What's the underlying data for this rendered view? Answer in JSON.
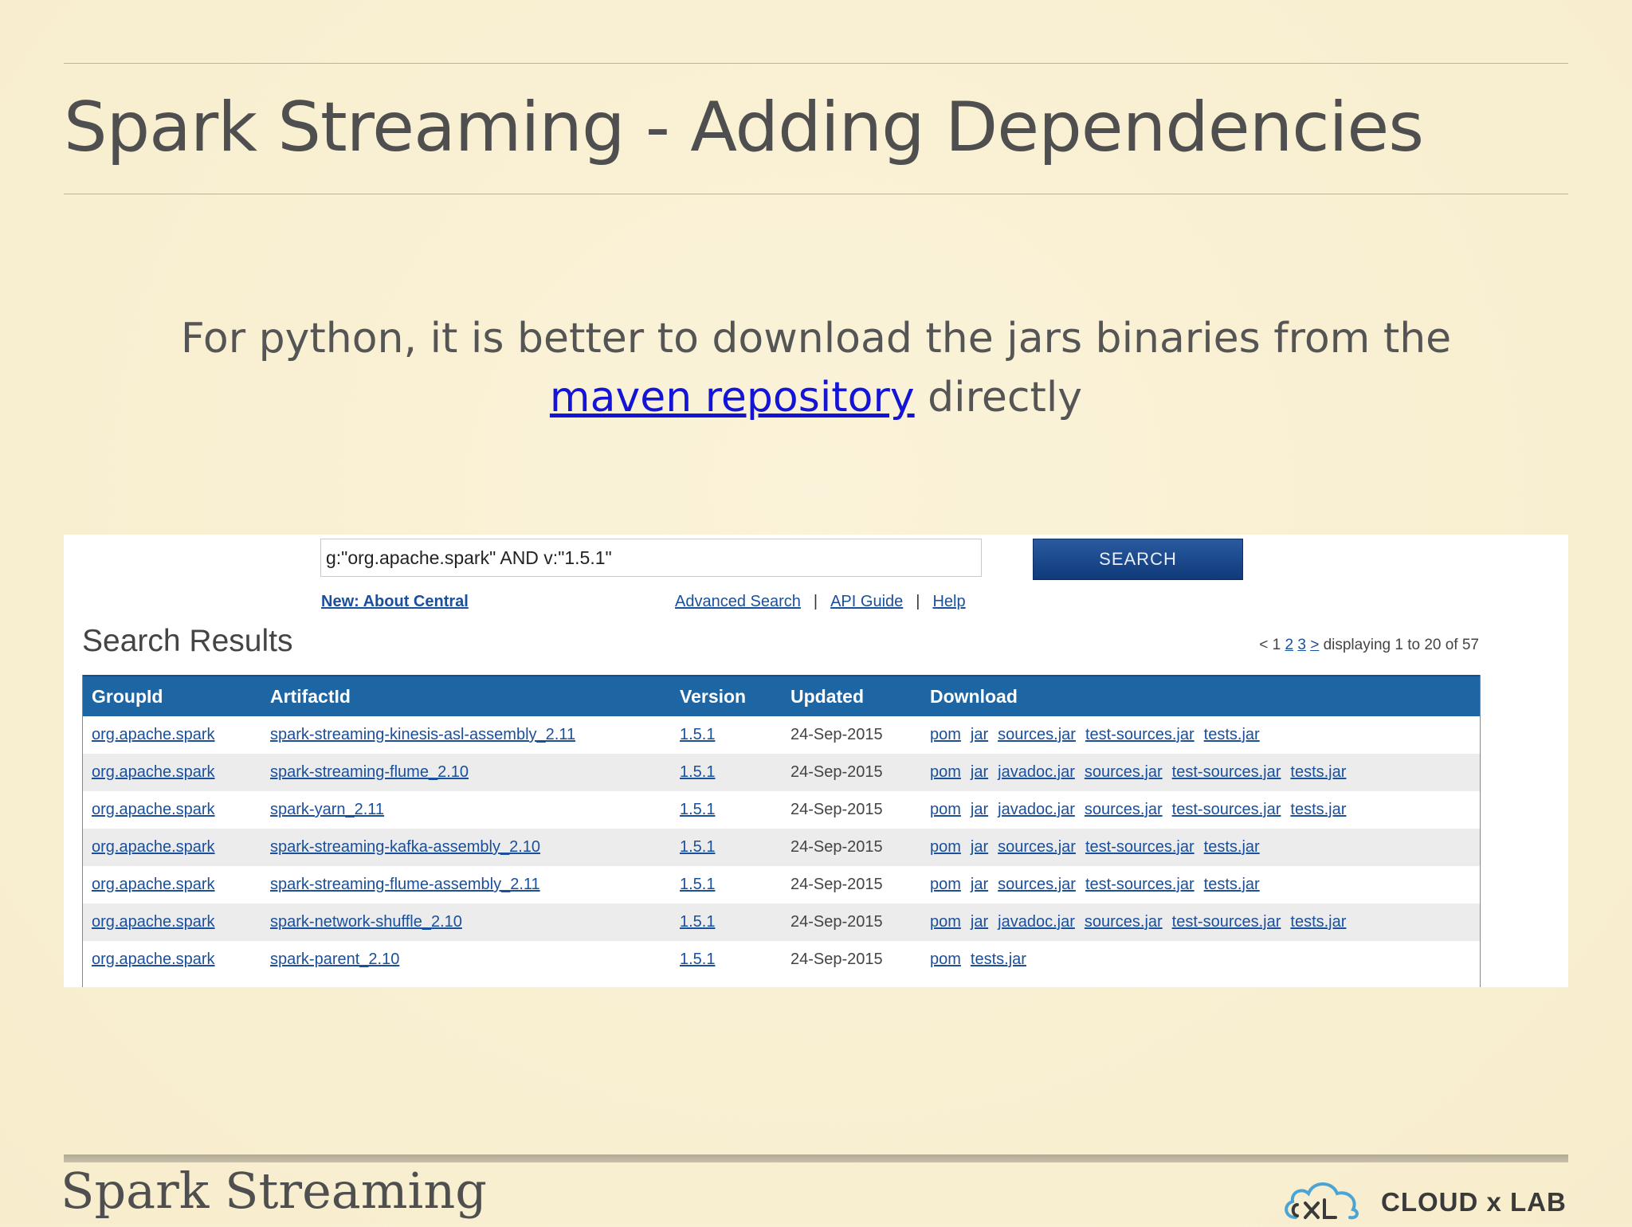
{
  "slide": {
    "title": "Spark Streaming - Adding Dependencies",
    "subtitle_text": "For python, it is better to download the jars binaries from the",
    "subtitle_link": "maven repository",
    "subtitle_tail": "directly",
    "footer_title": "Spark Streaming",
    "logo_text": "CLOUD x LAB"
  },
  "screenshot": {
    "search": {
      "value": "g:\"org.apache.spark\" AND v:\"1.5.1\"",
      "button_label": "SEARCH"
    },
    "links": {
      "new_central": "New: About Central",
      "advanced_search": "Advanced Search",
      "api_guide": "API Guide",
      "help": "Help",
      "separator": "|"
    },
    "results_heading": "Search Results",
    "pager": {
      "prev": "<",
      "pages": [
        "1",
        "2",
        "3"
      ],
      "next": ">",
      "summary": "displaying 1 to 20 of 57"
    },
    "columns": [
      "GroupId",
      "ArtifactId",
      "Version",
      "Updated",
      "Download"
    ],
    "rows": [
      {
        "group": "org.apache.spark",
        "artifact": "spark-streaming-kinesis-asl-assembly_2.11",
        "version": "1.5.1",
        "updated": "24-Sep-2015",
        "downloads": [
          "pom",
          "jar",
          "sources.jar",
          "test-sources.jar",
          "tests.jar"
        ]
      },
      {
        "group": "org.apache.spark",
        "artifact": "spark-streaming-flume_2.10",
        "version": "1.5.1",
        "updated": "24-Sep-2015",
        "downloads": [
          "pom",
          "jar",
          "javadoc.jar",
          "sources.jar",
          "test-sources.jar",
          "tests.jar"
        ]
      },
      {
        "group": "org.apache.spark",
        "artifact": "spark-yarn_2.11",
        "version": "1.5.1",
        "updated": "24-Sep-2015",
        "downloads": [
          "pom",
          "jar",
          "javadoc.jar",
          "sources.jar",
          "test-sources.jar",
          "tests.jar"
        ]
      },
      {
        "group": "org.apache.spark",
        "artifact": "spark-streaming-kafka-assembly_2.10",
        "version": "1.5.1",
        "updated": "24-Sep-2015",
        "downloads": [
          "pom",
          "jar",
          "sources.jar",
          "test-sources.jar",
          "tests.jar"
        ]
      },
      {
        "group": "org.apache.spark",
        "artifact": "spark-streaming-flume-assembly_2.11",
        "version": "1.5.1",
        "updated": "24-Sep-2015",
        "downloads": [
          "pom",
          "jar",
          "sources.jar",
          "test-sources.jar",
          "tests.jar"
        ]
      },
      {
        "group": "org.apache.spark",
        "artifact": "spark-network-shuffle_2.10",
        "version": "1.5.1",
        "updated": "24-Sep-2015",
        "downloads": [
          "pom",
          "jar",
          "javadoc.jar",
          "sources.jar",
          "test-sources.jar",
          "tests.jar"
        ]
      },
      {
        "group": "org.apache.spark",
        "artifact": "spark-parent_2.10",
        "version": "1.5.1",
        "updated": "24-Sep-2015",
        "downloads": [
          "pom",
          "tests.jar"
        ]
      }
    ]
  },
  "icons": {
    "logo": "cloud-xl-logo-icon"
  },
  "colors": {
    "link": "#1414d6",
    "table_header": "#1e65a4",
    "search_button": "#1f4f8f",
    "background": "#f9f0d3"
  }
}
